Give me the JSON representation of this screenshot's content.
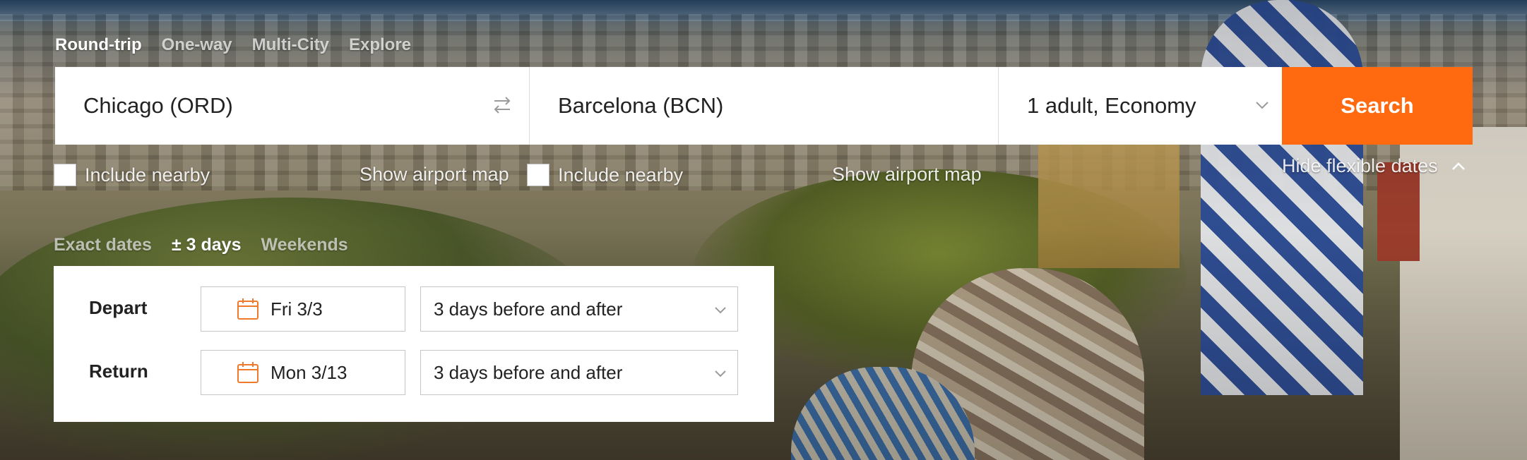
{
  "trip_types": [
    {
      "label": "Round-trip",
      "active": true
    },
    {
      "label": "One-way",
      "active": false
    },
    {
      "label": "Multi-City",
      "active": false
    },
    {
      "label": "Explore",
      "active": false
    }
  ],
  "search": {
    "origin": "Chicago (ORD)",
    "destination": "Barcelona (BCN)",
    "travelers": "1 adult, Economy",
    "button_label": "Search"
  },
  "options": {
    "origin_nearby": "Include nearby",
    "origin_map": "Show airport map",
    "dest_nearby": "Include nearby",
    "dest_map": "Show airport map",
    "hide_flexible": "Hide flexible dates"
  },
  "date_modes": [
    {
      "label": "Exact dates",
      "active": false
    },
    {
      "label": "± 3 days",
      "active": true
    },
    {
      "label": "Weekends",
      "active": false
    }
  ],
  "dates": {
    "depart_label": "Depart",
    "depart_date": "Fri 3/3",
    "depart_flex": "3 days before and after",
    "return_label": "Return",
    "return_date": "Mon 3/13",
    "return_flex": "3 days before and after"
  },
  "colors": {
    "accent": "#ff690f",
    "calendar_icon": "#f07a2c"
  }
}
